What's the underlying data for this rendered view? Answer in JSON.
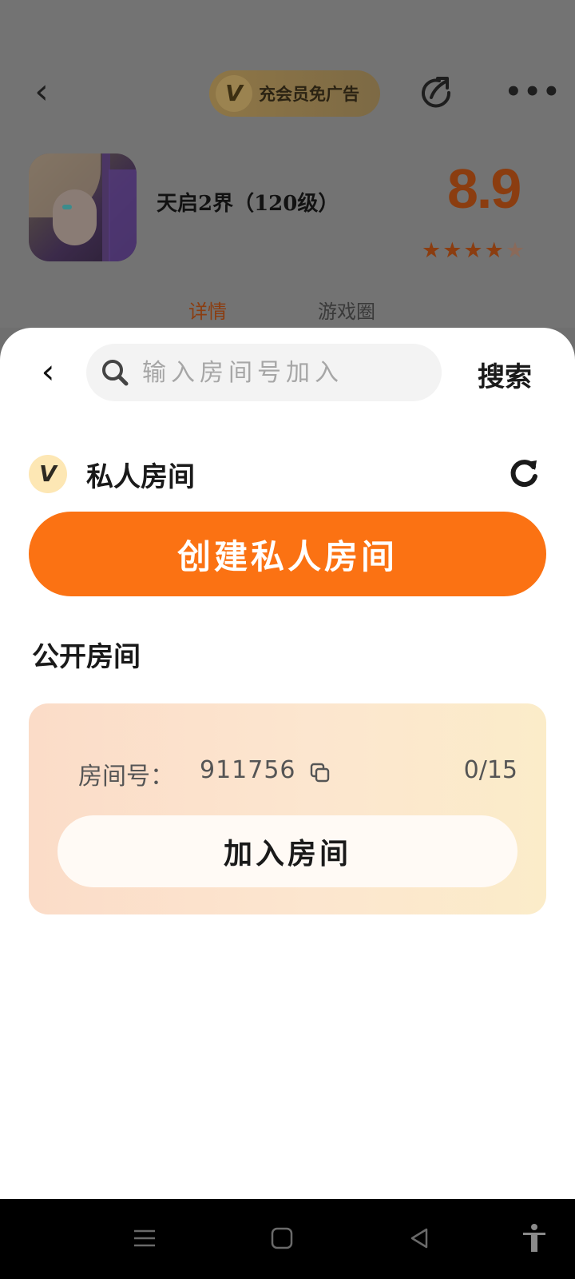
{
  "header": {
    "vip_badge": "V",
    "vip_text": "充会员免广告"
  },
  "game": {
    "title": "天启2界（120级）",
    "rating": "8.9",
    "stars": "★★★★",
    "half_star": "★",
    "tabs": [
      {
        "label": "详情",
        "active": true
      },
      {
        "label": "游戏圈",
        "active": false
      }
    ]
  },
  "sheet": {
    "search": {
      "placeholder": "输入房间号加入",
      "button": "搜索"
    },
    "private": {
      "badge": "V",
      "title": "私人房间",
      "create_button": "创建私人房间"
    },
    "public": {
      "title": "公开房间",
      "rooms": [
        {
          "id_label": "房间号：",
          "id": "911756",
          "count": "0/15",
          "join_button": "加入房间"
        }
      ]
    }
  },
  "colors": {
    "accent": "#fb7213",
    "rating": "#8b3d10",
    "card_gradient_start": "#fbdcc8",
    "card_gradient_end": "#fbecc9"
  }
}
